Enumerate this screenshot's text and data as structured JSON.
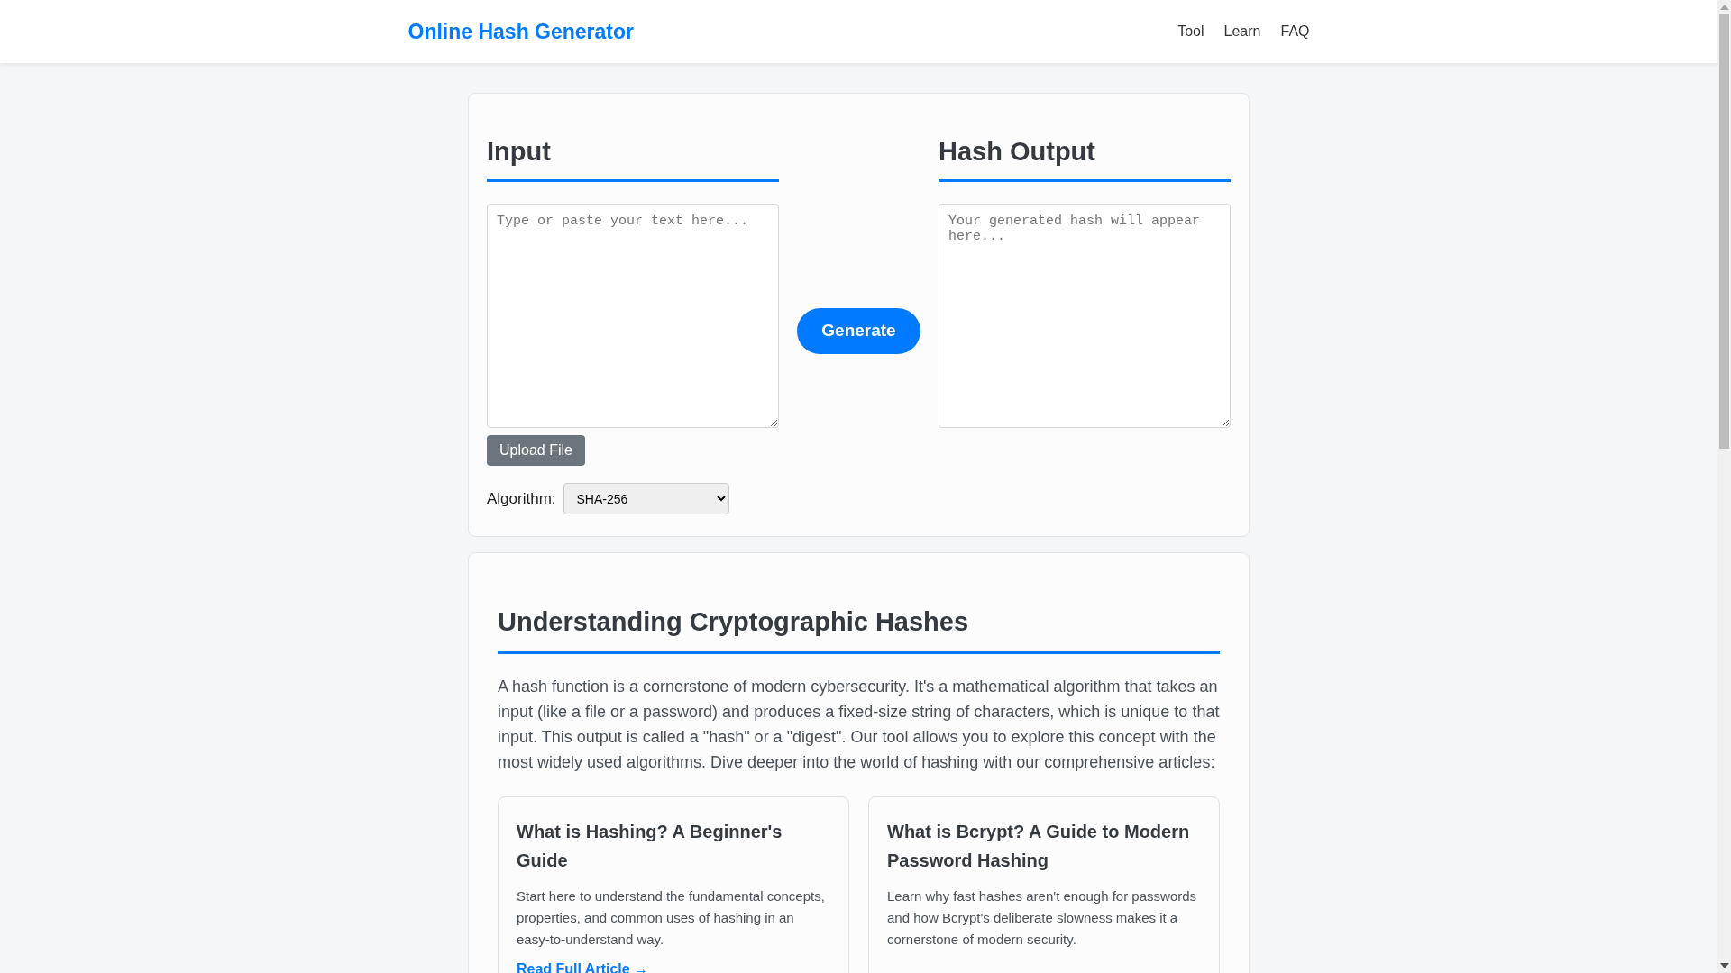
{
  "header": {
    "title": "Online Hash Generator",
    "nav": [
      {
        "label": "Tool"
      },
      {
        "label": "Learn"
      },
      {
        "label": "FAQ"
      }
    ]
  },
  "tool": {
    "input_heading": "Input",
    "input_placeholder": "Type or paste your text here...",
    "upload_button": "Upload File",
    "algorithm_label": "Algorithm:",
    "algorithm_value": "SHA-256",
    "generate_button": "Generate",
    "output_heading": "Hash Output",
    "output_placeholder": "Your generated hash will appear here..."
  },
  "learn": {
    "heading": "Understanding Cryptographic Hashes",
    "intro": "A hash function is a cornerstone of modern cybersecurity. It's a mathematical algorithm that takes an input (like a file or a password) and produces a fixed-size string of characters, which is unique to that input. This output is called a \"hash\" or a \"digest\". Our tool allows you to explore this concept with the most widely used algorithms. Dive deeper into the world of hashing with our comprehensive articles:",
    "articles": [
      {
        "title": "What is Hashing? A Beginner's Guide",
        "description": "Start here to understand the fundamental concepts, properties, and common uses of hashing in an easy-to-understand way.",
        "link": "Read Full Article →"
      },
      {
        "title": "What is Bcrypt? A Guide to Modern Password Hashing",
        "description": "Learn why fast hashes aren't enough for passwords and how Bcrypt's deliberate slowness makes it a cornerstone of modern security."
      }
    ]
  }
}
